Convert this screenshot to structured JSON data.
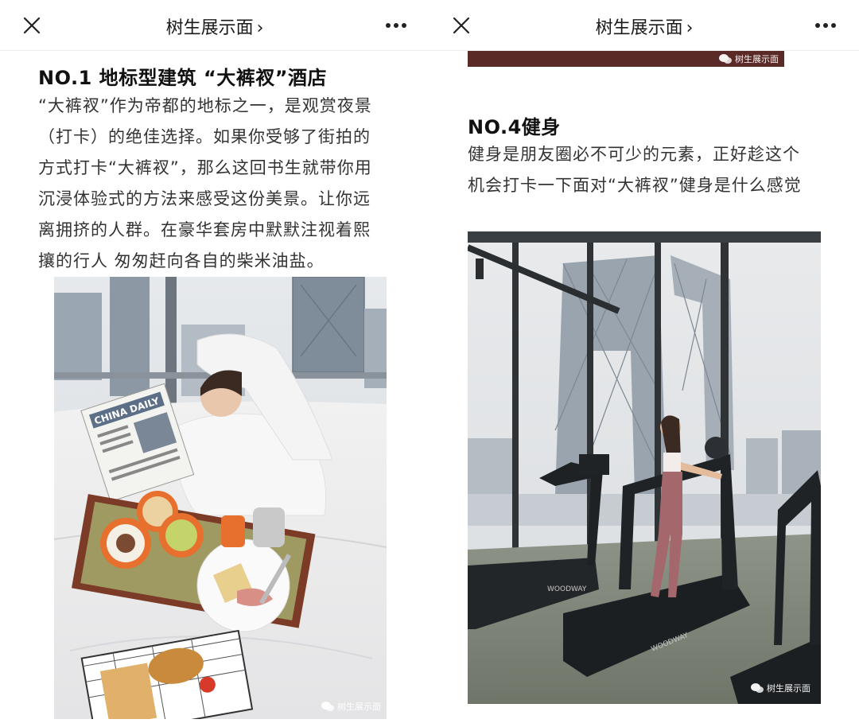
{
  "left": {
    "navbar": {
      "title": "树生展示面",
      "chevron": "›",
      "close_icon": "close-icon",
      "more_icon": "more-icon"
    },
    "heading": "NO.1 地标型建筑 “大裤衩”酒店",
    "paragraph_lines": [
      "“大裤衩”作为帝都的地标之一，是观赏夜景",
      "（打卡）的绝佳选择。如果你受够了街拍的",
      "方式打卡“大裤衩”，那么这回书生就带你用",
      "沉浸体验式的方法来感受这份美景。让你远",
      "离拥挤的人群。在豪华套房中默默注视着熙",
      "攘的行人 匆匆赶向各自的柴米油盐。"
    ],
    "photo": {
      "newspaper": "CHINA DAILY"
    },
    "watermark": "树生展示面"
  },
  "right": {
    "navbar": {
      "title": "树生展示面",
      "chevron": "›",
      "close_icon": "close-icon",
      "more_icon": "more-icon"
    },
    "top_watermark": "树生展示面",
    "heading": "NO.4健身",
    "paragraph_lines": [
      "健身是朋友圈必不可少的元素，正好趁这个",
      "机会打卡一下面对“大裤衩”健身是什么感觉"
    ],
    "photo": {
      "brand1": "WOODWAY",
      "brand2": "WOODWAY"
    },
    "watermark": "树生展示面"
  }
}
